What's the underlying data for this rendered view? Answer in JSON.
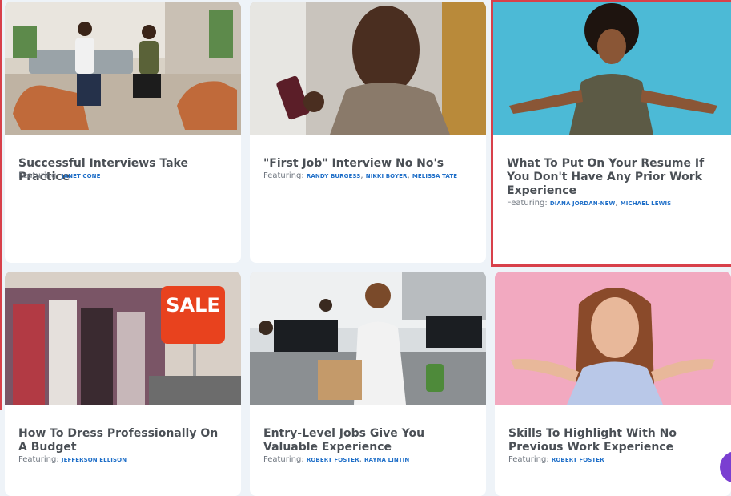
{
  "cards": [
    {
      "title": "Successful Interviews Take Practice",
      "featuring_label": "Featuring:",
      "people": [
        "JANET CONE"
      ]
    },
    {
      "title": "\"First Job\" Interview No No's",
      "featuring_label": "Featuring:",
      "people": [
        "RANDY BURGESS",
        "NIKKI BOYER",
        "MELISSA TATE"
      ]
    },
    {
      "title": "What To Put On Your Resume If You Don't Have Any Prior Work Experience",
      "featuring_label": "Featuring:",
      "people": [
        "DIANA JORDAN-NEW",
        "MICHAEL LEWIS"
      ]
    },
    {
      "title": "How To Dress Professionally On A Budget",
      "featuring_label": "Featuring:",
      "people": [
        "JEFFERSON ELLISON"
      ],
      "image_sign": "SALE"
    },
    {
      "title": "Entry-Level Jobs Give You Valuable Experience",
      "featuring_label": "Featuring:",
      "people": [
        "ROBERT FOSTER",
        "RAYNA LINTIN"
      ]
    },
    {
      "title": "Skills To Highlight With No Previous Work Experience",
      "featuring_label": "Featuring:",
      "people": [
        "ROBERT FOSTER"
      ]
    }
  ],
  "separator": ",",
  "colors": {
    "highlight": "#d8404a",
    "link": "#1f6fc8",
    "title": "#4a4f55",
    "chat_bubble": "#7a3fd1"
  }
}
